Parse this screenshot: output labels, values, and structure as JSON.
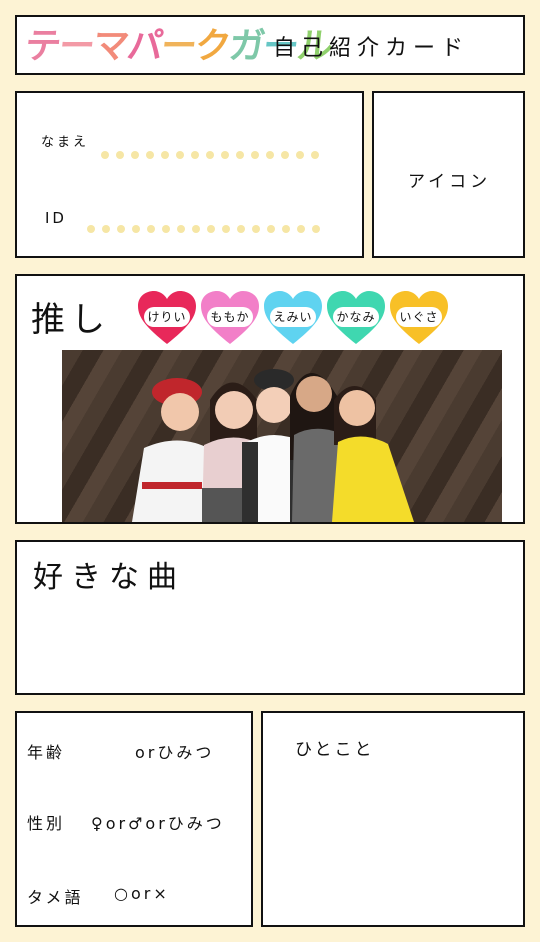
{
  "header": {
    "logo_chars": [
      {
        "ch": "テ",
        "color": "#ea7fa0"
      },
      {
        "ch": "ー",
        "color": "#f39aa6"
      },
      {
        "ch": "マ",
        "color": "#f28b7a"
      },
      {
        "ch": "パ",
        "color": "#e86a9a"
      },
      {
        "ch": "ー",
        "color": "#f0b35a"
      },
      {
        "ch": "ク",
        "color": "#f1a840"
      },
      {
        "ch": "ガ",
        "color": "#7ec8a8"
      },
      {
        "ch": "ー",
        "color": "#66c6c5"
      },
      {
        "ch": "ル",
        "color": "#8fd06c"
      }
    ],
    "title": "自己紹介カード"
  },
  "profile": {
    "name_label": "なまえ",
    "id_label": "ID",
    "icon_label": "アイコン"
  },
  "oshi": {
    "title": "推し",
    "members": [
      {
        "name": "けりい",
        "color": "#e8285a"
      },
      {
        "name": "ももか",
        "color": "#f27fc8"
      },
      {
        "name": "えみい",
        "color": "#5fd3f0"
      },
      {
        "name": "かなみ",
        "color": "#3fd7b0"
      },
      {
        "name": "いぐさ",
        "color": "#f8c027"
      }
    ]
  },
  "song": {
    "title": "好きな曲"
  },
  "info": {
    "age_label": "年齢",
    "age_value": "orひみつ",
    "gender_label": "性別",
    "gender_value": "♀or♂orひみつ",
    "tame_label": "タメ語",
    "tame_value": "○or×"
  },
  "comment": {
    "title": "ひとこと"
  }
}
